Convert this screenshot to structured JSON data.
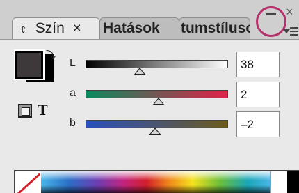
{
  "tabs": [
    {
      "label": "Szín",
      "close_glyph": "×"
    },
    {
      "label": "Hatások"
    },
    {
      "label": "tumstílusok"
    }
  ],
  "window": {
    "collapse_glyph": "–",
    "close_glyph": "×"
  },
  "color": {
    "fill_hex": "#3d393a",
    "stroke_hex": "#000000",
    "text_icon": "T"
  },
  "sliders": [
    {
      "label": "L",
      "value": "38",
      "position_percent": 38,
      "gradient": "linear-gradient(90deg,#000,#fff)"
    },
    {
      "label": "a",
      "value": "2",
      "position_percent": 51,
      "gradient": "linear-gradient(90deg,#0a8a5e,#e0224a)"
    },
    {
      "label": "b",
      "value": "–2",
      "position_percent": 49,
      "gradient": "linear-gradient(90deg,#2a4fbf,#6b5a1e)"
    }
  ],
  "icons": {
    "swap": "swap-arrow-icon",
    "panel_menu": "panel-menu-icon",
    "tab_arrows": "⇕"
  }
}
